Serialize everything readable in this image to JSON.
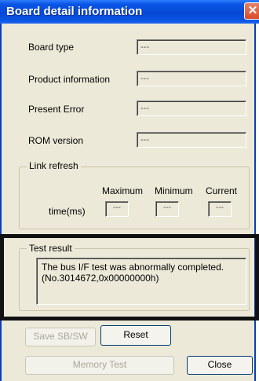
{
  "window": {
    "title": "Board detail information",
    "close_glyph": "✕"
  },
  "fields": [
    {
      "label": "Board type",
      "value": "---"
    },
    {
      "label": "Product information",
      "value": "---"
    },
    {
      "label": "Present Error",
      "value": "---"
    },
    {
      "label": "ROM version",
      "value": "---"
    }
  ],
  "link_refresh": {
    "title": "Link refresh",
    "row_label": "time(ms)",
    "columns": [
      "Maximum",
      "Minimum",
      "Current"
    ],
    "values": [
      "---",
      "---",
      "---"
    ]
  },
  "test_result": {
    "title": "Test result",
    "message": "The bus I/F test was abnormally completed.(No.3014672,0x00000000h)"
  },
  "buttons": {
    "save": "Save SB/SW",
    "reset": "Reset",
    "memory_test": "Memory Test",
    "close": "Close"
  },
  "colors": {
    "title_bar": "#0a56e6",
    "dialog_bg": "#ece9d8",
    "highlight": "#111111"
  }
}
